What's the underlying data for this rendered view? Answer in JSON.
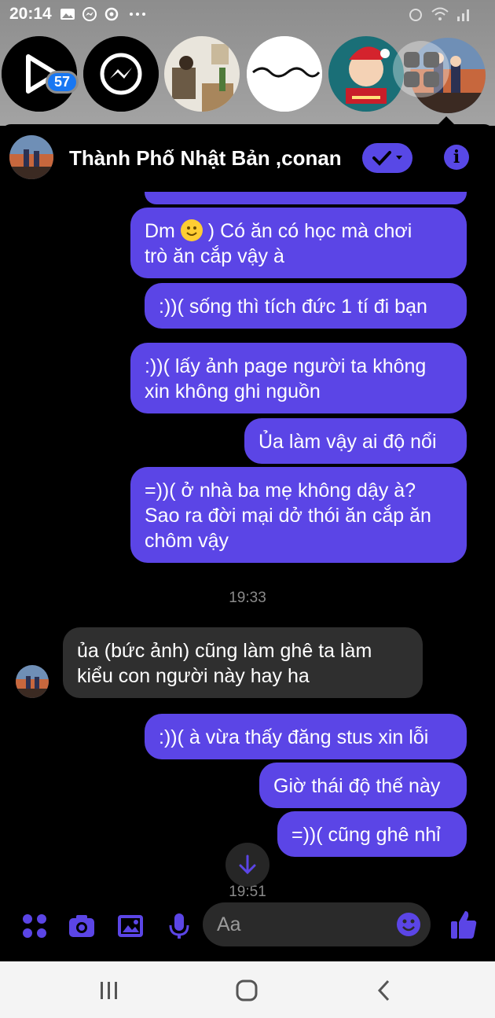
{
  "status": {
    "time": "20:14"
  },
  "chat_heads": {
    "badge_count": "57"
  },
  "header": {
    "title": "Thành Phố Nhật Bản ,conan"
  },
  "messages": [
    {
      "text_a": "Dm",
      "text_b": ") Có ăn có học mà chơi",
      "line2": "trò ăn cắp vậy à"
    },
    {
      "text": ":))( sống thì tích đức 1 tí đi bạn"
    },
    {
      "line1": ":))( lấy ảnh page người ta không",
      "line2": "xin không ghi nguồn"
    },
    {
      "text": "Ủa làm vậy ai độ nổi"
    },
    {
      "line1": "=))( ở nhà ba mẹ không dậy à?",
      "line2": "Sao ra đời mại dở thói ăn cắp ăn",
      "line3": "chôm vậy"
    },
    {
      "timestamp": "19:33"
    },
    {
      "line1": "ủa  (bức ảnh) cũng làm ghê ta làm",
      "line2": "kiểu con người này hay ha"
    },
    {
      "text": ":))( à vừa thấy đăng stus xin lỗi"
    },
    {
      "text": "Giờ thái độ thế này"
    },
    {
      "text": "=))( cũng ghê nhỉ"
    },
    {
      "timestamp": "19:51"
    }
  ],
  "composer": {
    "placeholder": "Aa"
  },
  "colors": {
    "accent": "#5b45e6",
    "incoming": "#2f2f2f",
    "background": "#000000"
  },
  "icons": [
    "apps-icon",
    "camera-icon",
    "gallery-icon",
    "microphone-icon",
    "emoji-icon",
    "like-icon",
    "info-icon",
    "check-icon"
  ]
}
